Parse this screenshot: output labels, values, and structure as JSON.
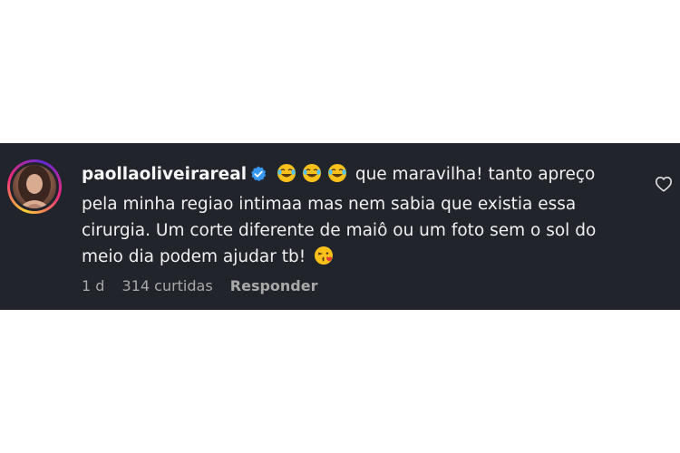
{
  "comment": {
    "username": "paollaoliveirareal",
    "verified": true,
    "emojis_leading": [
      "face-with-tears-of-joy",
      "face-with-tears-of-joy",
      "face-with-tears-of-joy"
    ],
    "text": "que maravilha! tanto apreço pela minha regiao intimaa mas nem sabia que existia essa cirurgia. Um corte diferente de maiô ou um foto sem o sol do meio dia podem ajudar tb!",
    "emoji_trailing": "face-blowing-a-kiss",
    "time": "1 d",
    "likes": "314 curtidas",
    "reply_label": "Responder",
    "like_icon": "heart-outline-icon"
  },
  "colors": {
    "card_background": "#21252b",
    "verified_badge": "#3897f0",
    "meta_text": "#a8a8a8"
  }
}
